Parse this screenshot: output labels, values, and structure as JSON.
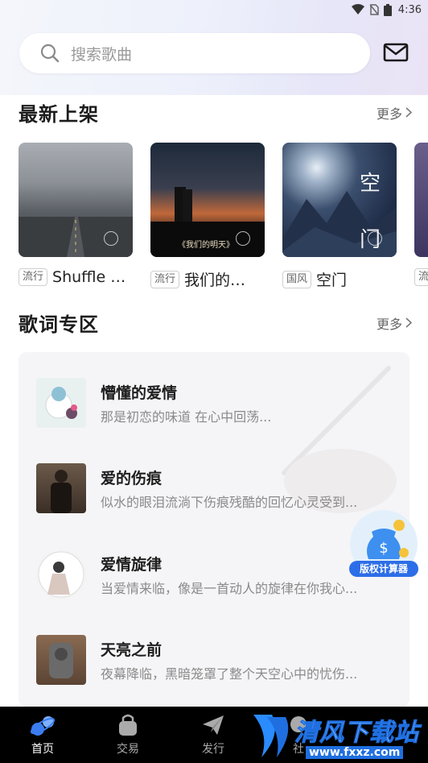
{
  "status": {
    "time": "4:36"
  },
  "search": {
    "placeholder": "搜索歌曲"
  },
  "new_releases": {
    "title": "最新上架",
    "more_label": "更多",
    "albums": [
      {
        "tag": "流行",
        "name": "Shuffle P..."
      },
      {
        "tag": "流行",
        "name": "我们的明..."
      },
      {
        "tag": "国风",
        "name": "空门"
      },
      {
        "tag": "流",
        "name": ""
      }
    ],
    "cover_texts": {
      "album2": "《我们的明天》",
      "album3": "空门"
    }
  },
  "lyrics": {
    "title": "歌词专区",
    "more_label": "更多",
    "items": [
      {
        "title": "懵懂的爱情",
        "desc": "那是初恋的味道 在心中回荡..."
      },
      {
        "title": "爱的伤痕",
        "desc": "似水的眼泪流淌下伤痕残酷的回忆心灵受到..."
      },
      {
        "title": "爱情旋律",
        "desc": "当爱情来临，像是一首动人的旋律在你我心..."
      },
      {
        "title": "天亮之前",
        "desc": "夜幕降临，黑暗笼罩了整个天空心中的忧伤..."
      }
    ]
  },
  "badge": {
    "label": "版权计算器"
  },
  "tabs": [
    {
      "label": "首页",
      "active": true
    },
    {
      "label": "交易",
      "active": false
    },
    {
      "label": "发行",
      "active": false
    },
    {
      "label": "社",
      "active": false
    }
  ],
  "watermark": {
    "title": "清风下载站",
    "url": "www.fxxz.com"
  },
  "colors": {
    "accent": "#5b8def",
    "tabbar_bg": "#000000",
    "card_bg": "#f5f5f7"
  }
}
